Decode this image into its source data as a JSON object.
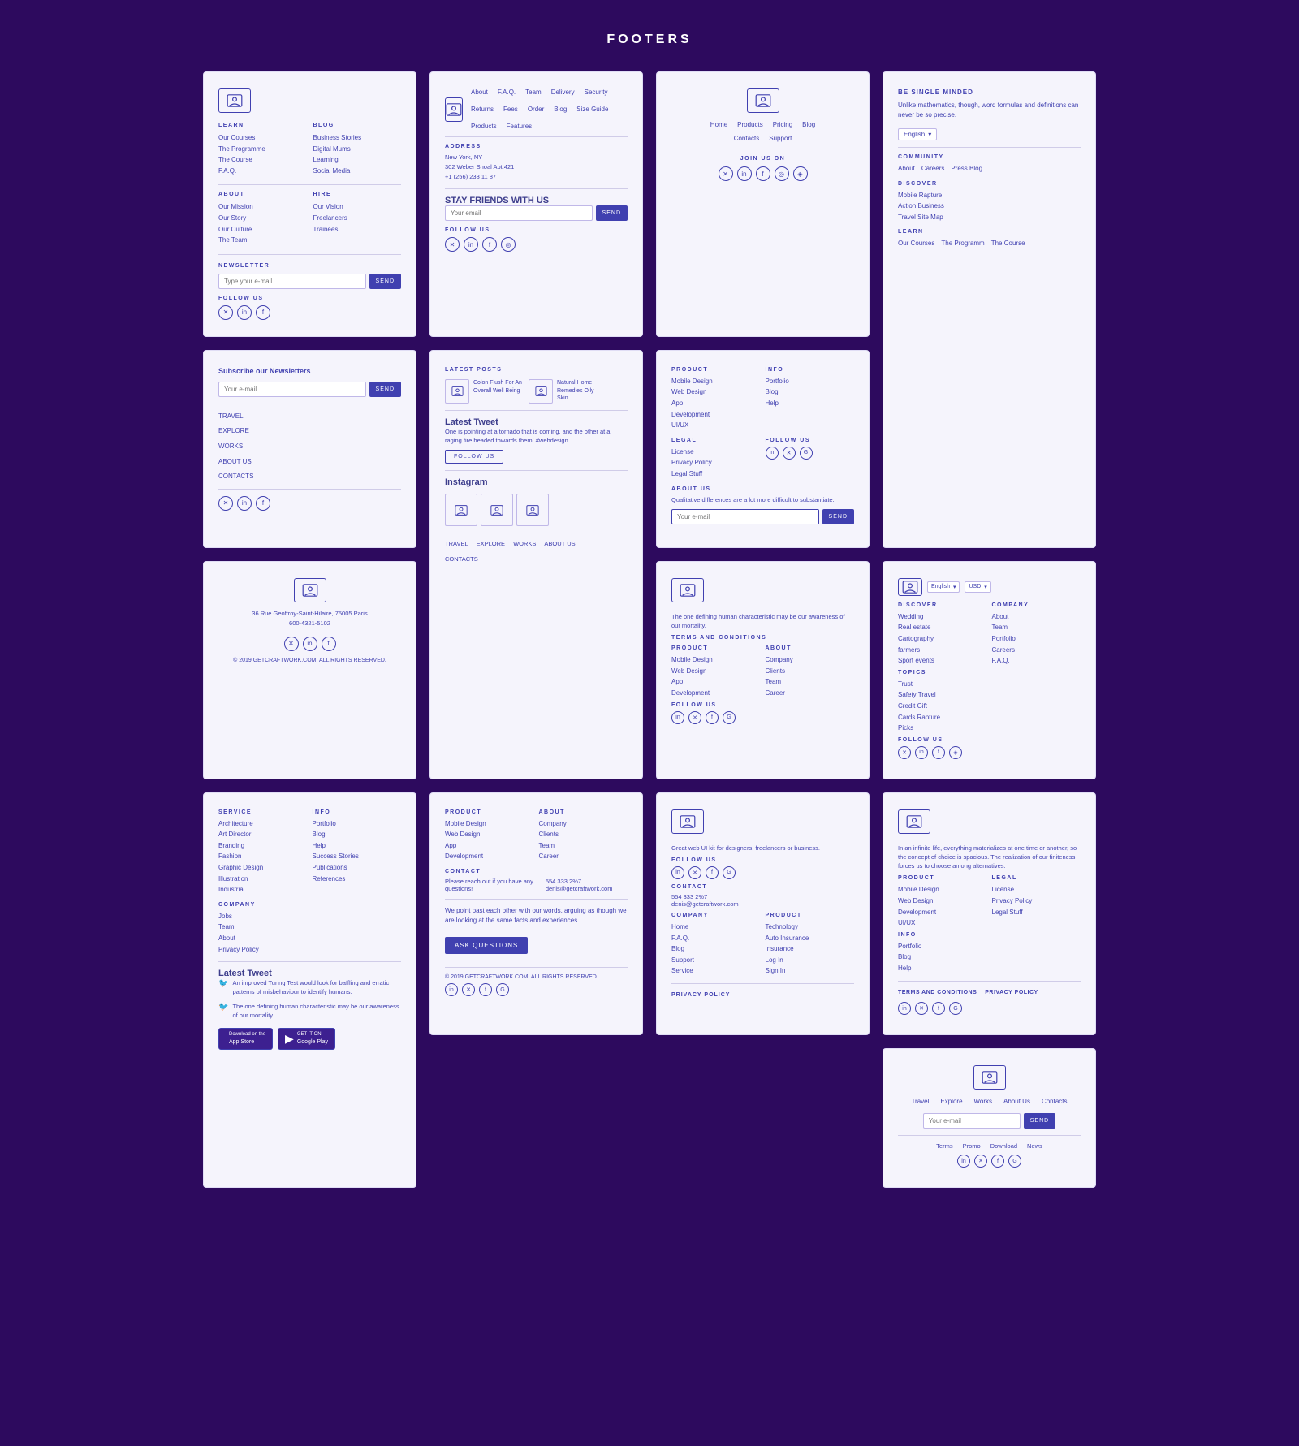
{
  "page": {
    "title": "FOOTERS",
    "bg_color": "#2d0a5e"
  },
  "card1": {
    "learn_label": "LEARN",
    "learn_links": [
      "Our Courses",
      "The Programme",
      "The Course",
      "F.A.Q."
    ],
    "blog_label": "BLOG",
    "blog_links": [
      "Business Stories",
      "Digital Mums",
      "Learning",
      "Social Media"
    ],
    "about_label": "ABOUT",
    "about_links": [
      "Our Mission",
      "Our Story",
      "Our Culture",
      "The Team"
    ],
    "hire_label": "HIRE",
    "hire_links": [
      "Our Vision",
      "Freelancers",
      "Trainees"
    ],
    "newsletter_label": "NEWSLETTER",
    "newsletter_placeholder": "Type your e-mail",
    "newsletter_btn": "SEND",
    "follow_label": "FOLLOW US"
  },
  "card2": {
    "top_nav": [
      "About",
      "F.A.Q.",
      "Team",
      "Delivery",
      "Security",
      "Returns",
      "Fees",
      "Order",
      "Blog",
      "Size Guide",
      "Products",
      "Features"
    ],
    "address_label": "ADDRESS",
    "address_lines": [
      "New York, NY",
      "302 Weber Shoal Apt.421",
      "+1 (256) 233 11 87"
    ],
    "stay_label": "STAY FRIENDS WITH US",
    "email_placeholder": "Your email",
    "send_btn": "SEND",
    "follow_label": "FOLLOW US"
  },
  "card3": {
    "nav": [
      "Home",
      "Products",
      "Pricing",
      "Blog",
      "Contacts",
      "Support"
    ],
    "join_label": "JOIN US ON"
  },
  "card4": {
    "title": "BE SINGLE MINDED",
    "tagline": "Unlike mathematics, though, word formulas and definitions can never be so precise.",
    "lang": "English",
    "community_label": "COMMUNITY",
    "community_links": [
      "About",
      "Careers",
      "Press Blog"
    ],
    "discover_label": "DISCOVER",
    "discover_links": [
      "Mobile Rapture",
      "Action Business",
      "Travel Site Map"
    ],
    "learn_label": "LEARN",
    "learn_links": [
      "Our Courses",
      "The Programm",
      "The Course"
    ]
  },
  "card5": {
    "subscribe_title": "Subscribe our Newsletters",
    "email_placeholder": "Your e-mail",
    "send_btn": "SEND",
    "travel": "TRAVEL",
    "explore": "EXPLORE",
    "works": "WORKS",
    "about": "ABOUT US",
    "contacts": "CONTACTS"
  },
  "card6": {
    "latest_posts_label": "Latest Posts",
    "posts": [
      {
        "title": "Colon Flush For An Overall Well Being"
      },
      {
        "title": "Natural Home Remedies Oily Skin"
      }
    ],
    "tweet_label": "Latest Tweet",
    "tweet_text": "One is pointing at a tornado that is coming, and the other at a raging fire headed towards them! #webdesign",
    "follow_btn": "FOLLOW US",
    "instagram_label": "Instagram",
    "footer_nav": [
      "TRAVEL",
      "EXPLORE",
      "WORKS",
      "ABOUT US"
    ],
    "contacts": "CONTACTS"
  },
  "card7": {
    "product_label": "PRODUCT",
    "product_links": [
      "Mobile Design",
      "Web Design",
      "App",
      "Development",
      "UI/UX"
    ],
    "info_label": "INFO",
    "info_links": [
      "Portfolio",
      "Blog",
      "Help"
    ],
    "legal_label": "LEGAL",
    "legal_links": [
      "License",
      "Privacy Policy",
      "Legal Stuff"
    ],
    "follow_label": "FOLLOW US",
    "about_label": "ABOUT US",
    "about_text": "Qualitative differences are a lot more difficult to substantiate.",
    "email_placeholder": "Your e-mail",
    "send_btn": "SEND"
  },
  "card8": {
    "logo_present": true,
    "tagline": "The one defining human characteristic may be our awareness of our mortality.",
    "terms_label": "TERMS AND CONDITIONS",
    "product_label": "PRODUCT",
    "product_links": [
      "Mobile Design",
      "Web Design",
      "App",
      "Development"
    ],
    "about_label": "ABOUT",
    "about_links": [
      "Company",
      "Clients",
      "Team",
      "Career"
    ],
    "follow_label": "FOLLOW US"
  },
  "card9": {
    "logo_present": true,
    "tagline": "Great web UI kit for designers, freelancers or business.",
    "follow_label": "FOLLOW US",
    "contact_label": "CONTACT",
    "contact_phone": "554 333 2%7",
    "contact_email": "denis@getcraftwork.com",
    "company_label": "COMPANY",
    "company_links": [
      "Home",
      "F.A.Q.",
      "Blog",
      "Support",
      "Service"
    ],
    "product_label": "PRODUCT",
    "product_links": [
      "Technology",
      "Auto Insurance",
      "Insurance",
      "Log In",
      "Sign In"
    ],
    "privacy_label": "PRIVACY POLICY"
  },
  "card10": {
    "lang_label": "English",
    "currency_label": "USD",
    "discover_label": "DISCOVER",
    "discover_links": [
      "Wedding",
      "Real estate",
      "Cartography",
      "farmers",
      "Sport events"
    ],
    "company_label": "COMPANY",
    "company_links": [
      "About",
      "Team",
      "Portfolio",
      "Careers",
      "F.A.Q."
    ],
    "topics_label": "TOPICS",
    "topics_links": [
      "Trust",
      "Safety Travel",
      "Credit Gift",
      "Cards Rapture",
      "Picks"
    ],
    "follow_label": "FOLLOW US"
  },
  "card11": {
    "logo_present": true,
    "tagline": "In an infinite life, everything materializes at one time or another, so the concept of choice is spacious. The realization of our finiteness forces us to choose among alternatives.",
    "product_label": "PRODUCT",
    "product_links": [
      "Mobile Design",
      "Web Design",
      "Development",
      "UI/UX"
    ],
    "legal_label": "LEGAL",
    "legal_links": [
      "License",
      "Privacy Policy",
      "Legal Stuff"
    ],
    "info_label": "INFO",
    "info_links": [
      "Portfolio",
      "Blog",
      "Help"
    ],
    "terms_label": "TERMS AND CONDITIONS",
    "privacy_label": "PRIVACY POLICY"
  },
  "card12": {
    "travel": "Travel",
    "explore": "Explore",
    "works": "Works",
    "about": "About Us",
    "contacts": "Contacts",
    "email_placeholder": "Your e-mail",
    "send_btn": "SEND",
    "terms_links": [
      "Terms",
      "Promo",
      "Download",
      "News"
    ]
  },
  "card13": {
    "product_label": "PRODUCT",
    "product_links": [
      "Mobile Design",
      "Web Design",
      "App",
      "Development"
    ],
    "about_label": "ABOUT",
    "about_links": [
      "Company",
      "Clients",
      "Team",
      "Career"
    ],
    "contact_label": "CONTACT",
    "contact_text": "Please reach out if you have any questions!",
    "contact_phone": "554 333 2%7",
    "contact_email": "denis@getcraftwork.com",
    "body_text": "We point past each other with our words, arguing as though we are looking at the same facts and experiences.",
    "ask_btn": "ASK QUESTIONS",
    "copyright": "© 2019 GETCRAFTWORK.COM. ALL RIGHTS RESERVED."
  },
  "card14": {
    "service_label": "SERVICE",
    "service_links": [
      "Architecture",
      "Art Director",
      "Branding",
      "Fashion",
      "Graphic Design",
      "Illustration",
      "Industrial"
    ],
    "info_label": "INFO",
    "info_links": [
      "Portfolio",
      "Blog",
      "Help",
      "Success Stories",
      "Publications",
      "References"
    ],
    "company_label": "COMPANY",
    "company_links": [
      "Jobs",
      "Team",
      "About",
      "Privacy Policy"
    ],
    "latest_tweet_label": "Latest Tweet",
    "tweets": [
      "An improved Turing Test would look for baffling and erratic patterns of misbehaviour to identify humans.",
      "The one defining human characteristic may be our awareness of our mortality."
    ],
    "app_store": "App Store",
    "google_play": "Google Play"
  },
  "card_addr": {
    "logo_present": true,
    "address": "36 Rue Geoffroy-Saint-Hilaire, 75005 Paris",
    "phone": "600-4321-5102",
    "copyright": "© 2019 GETCRAFTWORK.COM. ALL RIGHTS RESERVED."
  }
}
